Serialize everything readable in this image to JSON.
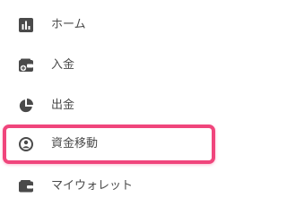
{
  "sidebar": {
    "items": [
      {
        "label": "ホーム",
        "icon": "bar-chart-icon"
      },
      {
        "label": "入金",
        "icon": "wallet-plus-icon"
      },
      {
        "label": "出金",
        "icon": "pie-chart-icon"
      },
      {
        "label": "資金移動",
        "icon": "transfer-circle-icon",
        "highlighted": true
      },
      {
        "label": "マイウォレット",
        "icon": "wallet-icon"
      }
    ]
  },
  "colors": {
    "icon": "#4a4a4a",
    "text": "#4a4a4a",
    "highlight_border": "#f0457c"
  }
}
